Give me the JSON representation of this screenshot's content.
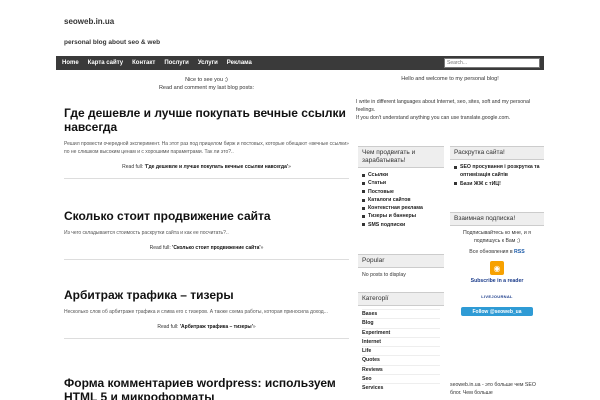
{
  "site": {
    "title": "seoweb.in.ua",
    "description": "personal blog about seo & web"
  },
  "nav": {
    "items": [
      "Home",
      "Карта сайту",
      "Контакт",
      "Послуги",
      "Услуги",
      "Реклама"
    ],
    "search_placeholder": "Search..."
  },
  "main": {
    "intro_line1": "Nice to see you ;)",
    "intro_line2": "Read and comment my last blog posts:",
    "posts": [
      {
        "title": "Где дешевле и лучше покупать вечные ссылки навсегда",
        "excerpt": "Решил провести очередной эксперимент. На этот раз под прицелом бирж и постовых, которые обещают «вечные ссылки» по не слишком высоким ценам и с хорошими параметрами. Так ли это?..",
        "read_prefix": "Read full: ",
        "read_link": "'Где дешевле и лучше покупать вечные ссылки навсегда'",
        "read_suffix": "»"
      },
      {
        "title": "Сколько стоит продвижение сайта",
        "excerpt": "Из чего складывается стоимость раскрутки сайта и как ее посчитать?..",
        "read_prefix": "Read full: ",
        "read_link": "'Сколько стоит продвижение сайта'",
        "read_suffix": "»"
      },
      {
        "title": "Арбитраж трафика – тизеры",
        "excerpt": "Несколько слов об арбитраже трафика и слива его с тизеров. А также схема работы, которая приносила доход...",
        "read_prefix": "Read full: ",
        "read_link": "'Арбитраж трафика – тизеры'",
        "read_suffix": "»"
      },
      {
        "title": "Форма комментариев wordpress: используем HTML 5 и микроформаты",
        "excerpt": "",
        "read_prefix": "",
        "read_link": "",
        "read_suffix": ""
      }
    ]
  },
  "right": {
    "welcome": "Hello and welcome to my personal blog!",
    "about_line1": "I write in different languages about Internet, seo, sites, soft and my personal feelings.",
    "about_line2": "If you don't understand anything you can use translate.google.com.",
    "widget_promote": {
      "title": "Чем продвигать и зарабатывать!",
      "items": [
        "Ссылки",
        "Статьи",
        "Постовые",
        "Каталоги сайтов",
        "Контекстная реклама",
        "Тизеры и баннеры",
        "SMS подписки"
      ]
    },
    "widget_popular": {
      "title": "Popular",
      "text": "No posts to display"
    },
    "widget_categories": {
      "title": "Категорії",
      "items": [
        "Bases",
        "Blog",
        "Experiment",
        "Internet",
        "Life",
        "Quotes",
        "Reviews",
        "Seo",
        "Services"
      ]
    },
    "widget_raskrutka": {
      "title": "Раскрутка сайта!",
      "items": [
        "SEO просування і розкрутка та оптимізація сайтів",
        "Бази ЖЖ с тИЦ!"
      ]
    },
    "widget_subscribe": {
      "title": "Взаимная подписка!",
      "text": "Подписывайтесь ко мне, и я подпишусь к Вам ;)",
      "rss_text_prefix": "Все обновления в ",
      "rss_link": "RSS",
      "reader_link": "Subscribe in a reader",
      "lj_label": "LIVEJOURNAL",
      "twitter_label": "Follow @seoweb_ua"
    },
    "footer_text": "seoweb.in.ua - это больше чем SEO блог. Чем больше"
  }
}
